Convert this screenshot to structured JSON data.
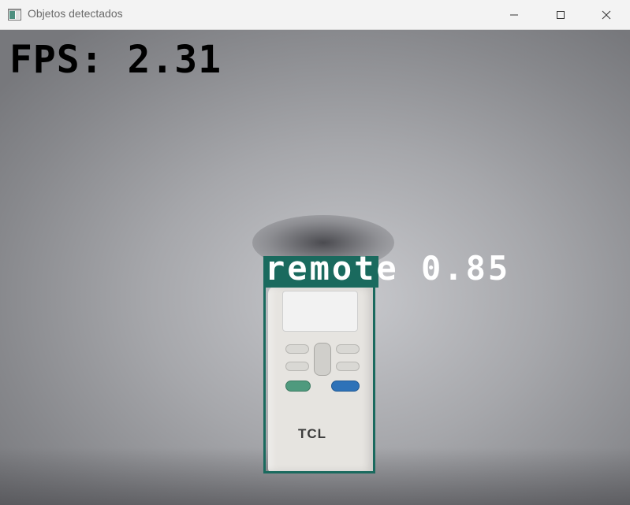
{
  "window": {
    "title": "Objetos detectados",
    "icon": "window-app-icon",
    "controls": [
      "minimize-icon",
      "maximize-icon",
      "close-icon"
    ]
  },
  "overlay": {
    "fps_text": "FPS: 2.31"
  },
  "detections": [
    {
      "label_text": "remote 0.85",
      "class": "remote",
      "confidence": 0.85,
      "color": "#1a6a5e"
    }
  ],
  "scene": {
    "remote_brand": "TCL"
  },
  "colors": {
    "box": "#1a6a5e",
    "label_text": "#ffffff",
    "fps_text": "#000000",
    "titlebar": "#f3f3f3"
  }
}
